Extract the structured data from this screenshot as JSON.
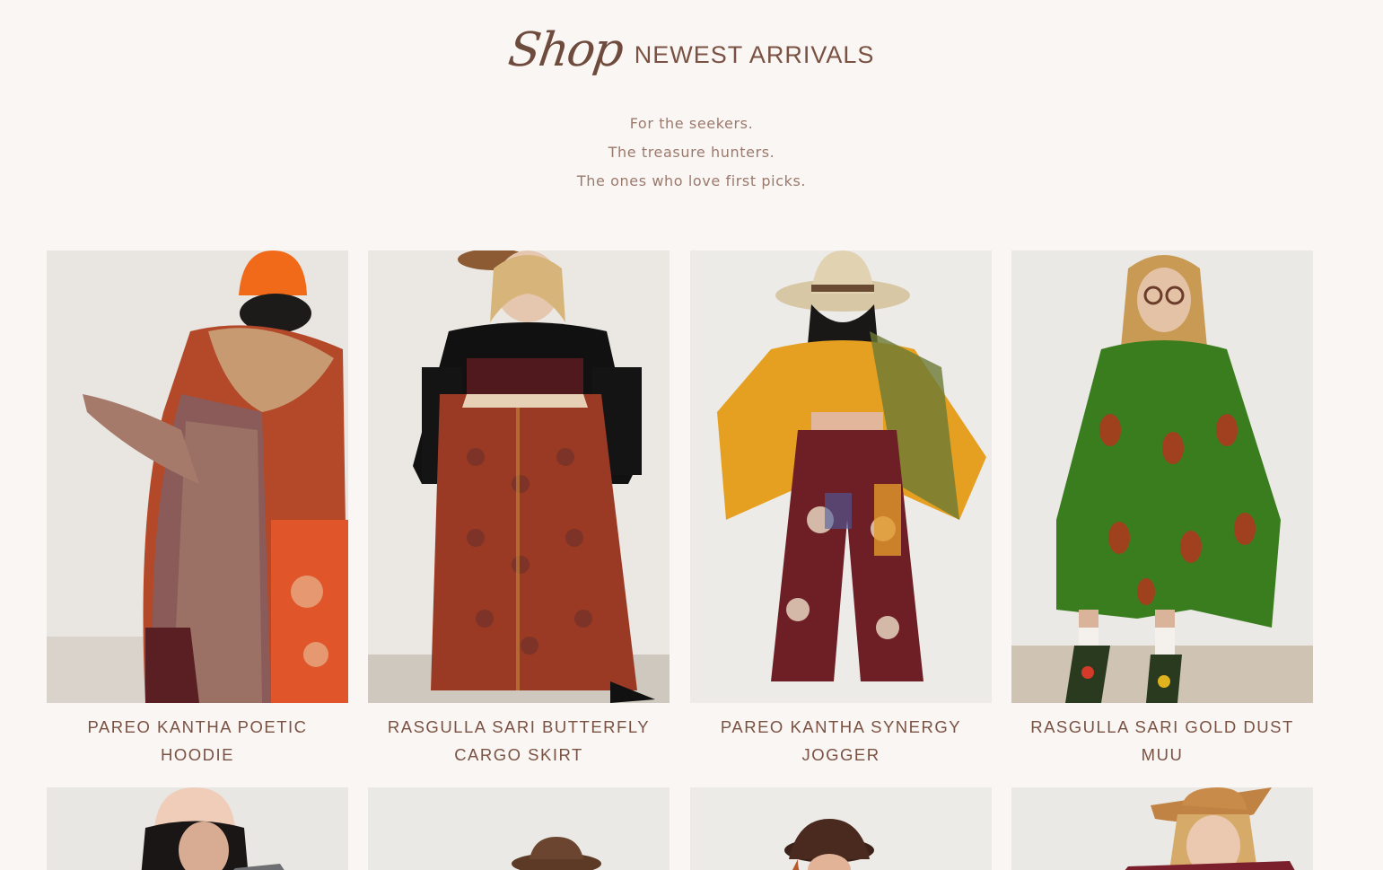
{
  "section": {
    "script_word": "Shop",
    "title": "NEWEST ARRIVALS",
    "tagline": [
      "For the seekers.",
      "The treasure hunters.",
      "The ones who love first picks."
    ]
  },
  "products": [
    {
      "title": "PAREO KANTHA POETIC HOODIE"
    },
    {
      "title": "RASGULLA SARI BUTTERFLY CARGO SKIRT"
    },
    {
      "title": "PAREO KANTHA SYNERGY JOGGER"
    },
    {
      "title": "RASGULLA SARI GOLD DUST MUU"
    }
  ],
  "colors": {
    "background": "#faf6f3",
    "heading": "#7a5244",
    "tagline": "#9b7a6d"
  }
}
